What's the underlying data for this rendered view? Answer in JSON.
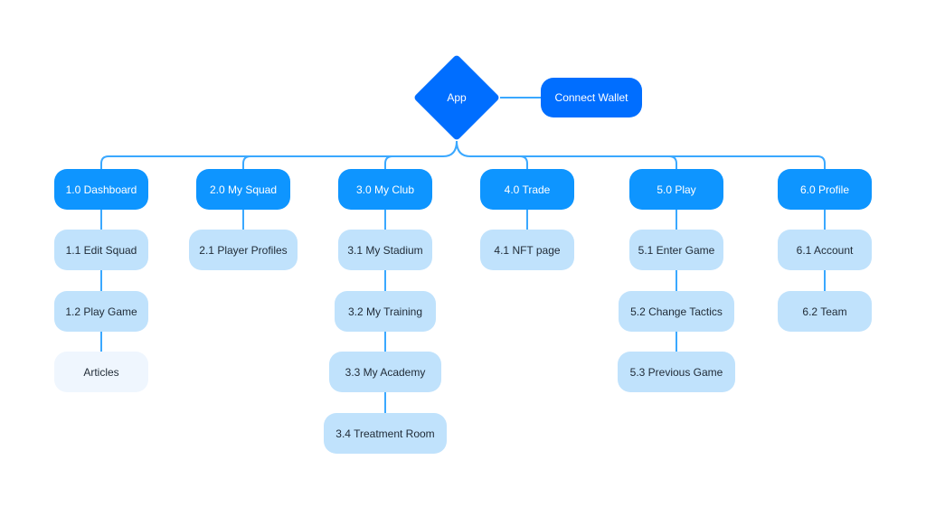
{
  "colors": {
    "root": "#006EFF",
    "section": "#0E95FF",
    "page": "#C0E2FC",
    "inactive": "#EFF6FE",
    "connector": "#3AA8FF"
  },
  "root": {
    "label": "App"
  },
  "wallet": {
    "label": "Connect Wallet"
  },
  "sections": [
    {
      "label": "1.0 Dashboard",
      "children": [
        "1.1 Edit Squad",
        "1.2 Play Game",
        "Articles"
      ]
    },
    {
      "label": "2.0 My Squad",
      "children": [
        "2.1 Player Profiles"
      ]
    },
    {
      "label": "3.0 My Club",
      "children": [
        "3.1 My Stadium",
        "3.2 My Training",
        "3.3 My Academy",
        "3.4 Treatment Room"
      ]
    },
    {
      "label": "4.0 Trade",
      "children": [
        "4.1 NFT page"
      ]
    },
    {
      "label": "5.0 Play",
      "children": [
        "5.1 Enter Game",
        "5.2 Change Tactics",
        "5.3 Previous Game"
      ]
    },
    {
      "label": "6.0 Profile",
      "children": [
        "6.1 Account",
        "6.2 Team"
      ]
    }
  ]
}
